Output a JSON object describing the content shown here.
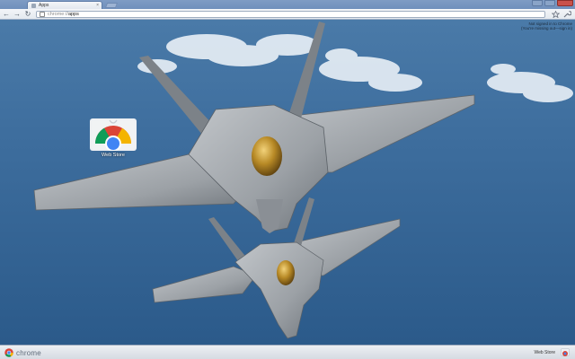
{
  "tab": {
    "title": "Apps",
    "favicon": "apps-grid-icon",
    "close_glyph": "×"
  },
  "toolbar": {
    "back_glyph": "←",
    "forward_glyph": "→",
    "reload_glyph": "↻",
    "url_scheme": "chrome://",
    "url_path": "apps"
  },
  "profile": {
    "line1": "Not signed in to Chrome",
    "line2": "(You're missing out—sign in)"
  },
  "apps": [
    {
      "label": "Web Store",
      "icon": "web-store-icon"
    }
  ],
  "footer": {
    "brand": "chrome",
    "web_store_label": "Web Store"
  },
  "colors": {
    "sky": "#3f6c9c",
    "sea": "#2f5e8f",
    "jet": "#9ea3a8",
    "canopy": "#b8902c",
    "chrome_red": "#db4437",
    "chrome_green": "#0f9d58",
    "chrome_yellow": "#f4b400",
    "chrome_blue": "#4285f4"
  }
}
